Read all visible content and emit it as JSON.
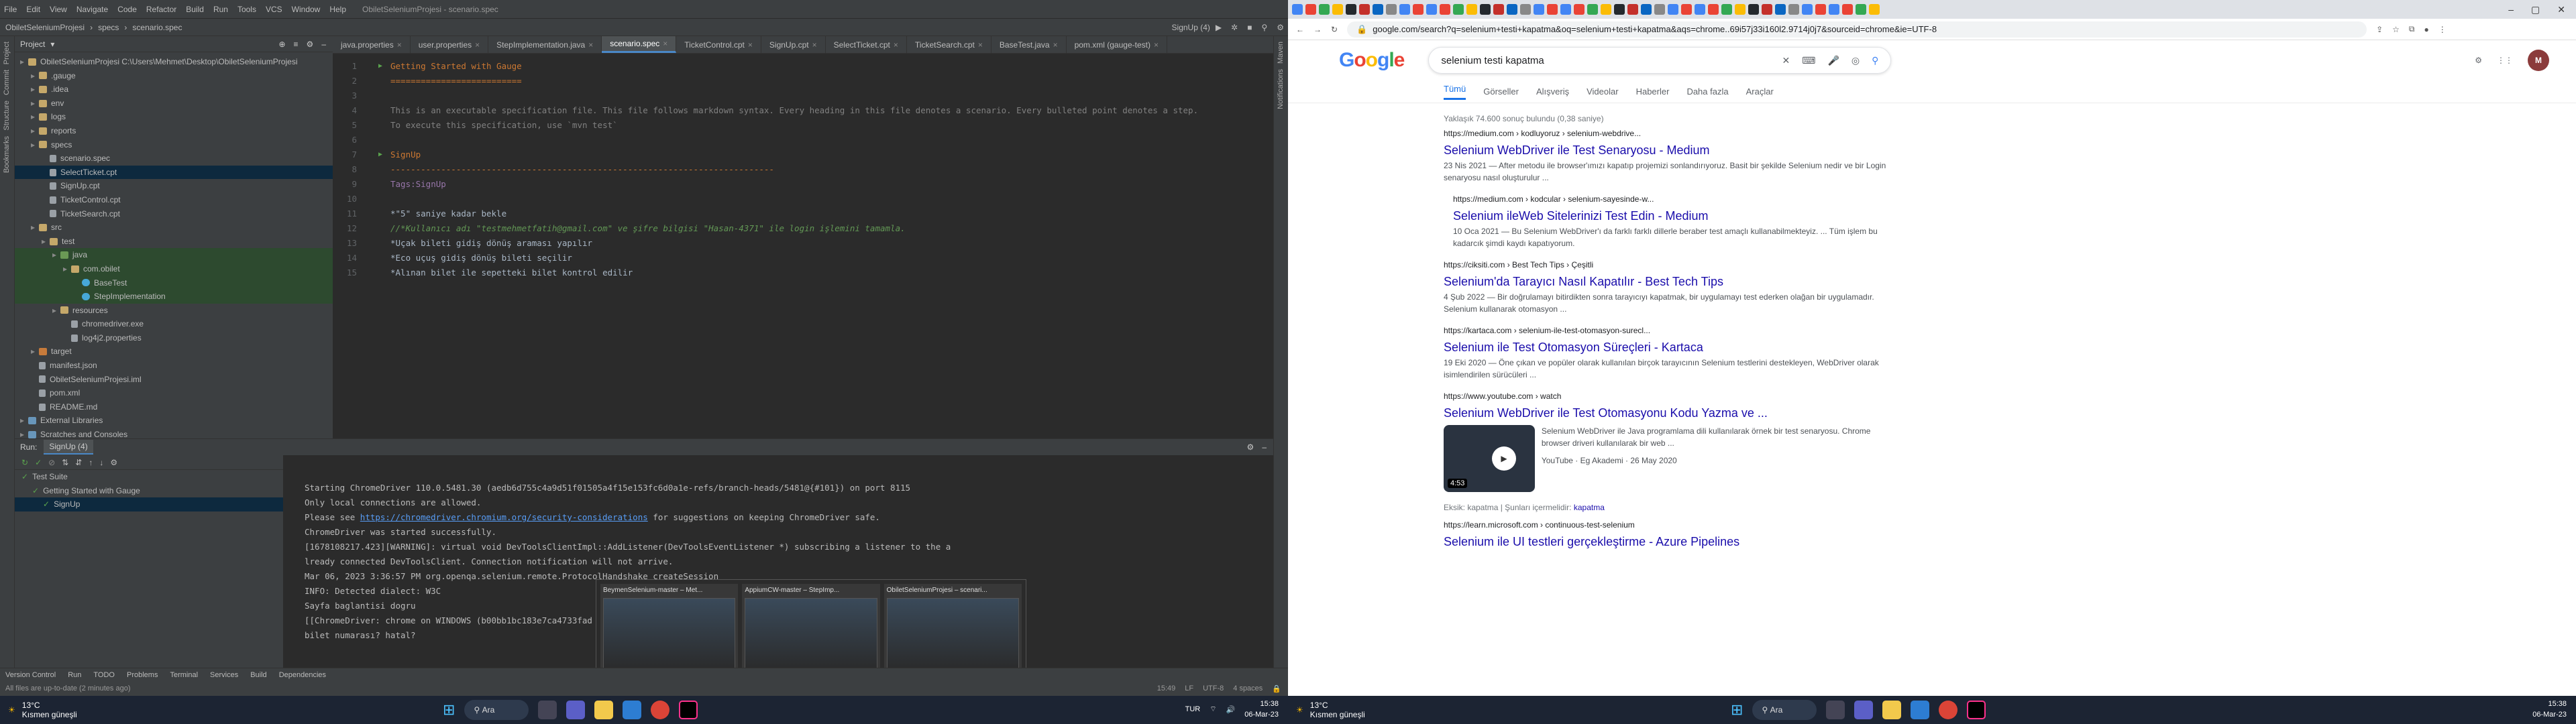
{
  "ide": {
    "menu": [
      "File",
      "Edit",
      "View",
      "Navigate",
      "Code",
      "Refactor",
      "Build",
      "Run",
      "Tools",
      "VCS",
      "Window",
      "Help"
    ],
    "window_title": "ObiletSeleniumProjesi - scenario.spec",
    "breadcrumb": [
      "ObiletSeleniumProjesi",
      "specs",
      "scenario.spec"
    ],
    "run_config": "SignUp (4)",
    "project_pane": {
      "title": "Project",
      "tree": [
        {
          "label": "ObiletSeleniumProjesi  C:\\Users\\Mehmet\\Desktop\\ObiletSeleniumProjesi",
          "icon": "fold",
          "indent": 0
        },
        {
          "label": ".gauge",
          "icon": "fold",
          "indent": 1
        },
        {
          "label": ".idea",
          "icon": "fold",
          "indent": 1
        },
        {
          "label": "env",
          "icon": "fold",
          "indent": 1
        },
        {
          "label": "logs",
          "icon": "fold",
          "indent": 1
        },
        {
          "label": "reports",
          "icon": "fold",
          "indent": 1
        },
        {
          "label": "specs",
          "icon": "fold",
          "indent": 1
        },
        {
          "label": "scenario.spec",
          "icon": "file",
          "indent": 2
        },
        {
          "label": "SelectTicket.cpt",
          "icon": "file",
          "indent": 2,
          "selected": true
        },
        {
          "label": "SignUp.cpt",
          "icon": "file",
          "indent": 2
        },
        {
          "label": "TicketControl.cpt",
          "icon": "file",
          "indent": 2
        },
        {
          "label": "TicketSearch.cpt",
          "icon": "file",
          "indent": 2
        },
        {
          "label": "src",
          "icon": "fold",
          "indent": 1
        },
        {
          "label": "test",
          "icon": "fold",
          "indent": 2
        },
        {
          "label": "java",
          "icon": "fgreen",
          "indent": 3,
          "highlight": true
        },
        {
          "label": "com.obilet",
          "icon": "fold",
          "indent": 4,
          "highlight": true
        },
        {
          "label": "BaseTest",
          "icon": "fjava",
          "indent": 5,
          "highlight": true
        },
        {
          "label": "StepImplementation",
          "icon": "fjava",
          "indent": 5,
          "highlight": true
        },
        {
          "label": "resources",
          "icon": "fold",
          "indent": 3
        },
        {
          "label": "chromedriver.exe",
          "icon": "file",
          "indent": 4
        },
        {
          "label": "log4j2.properties",
          "icon": "file",
          "indent": 4
        },
        {
          "label": "target",
          "icon": "ftarget",
          "indent": 1
        },
        {
          "label": "manifest.json",
          "icon": "file",
          "indent": 1
        },
        {
          "label": "ObiletSeleniumProjesi.iml",
          "icon": "file",
          "indent": 1
        },
        {
          "label": "pom.xml",
          "icon": "file",
          "indent": 1
        },
        {
          "label": "README.md",
          "icon": "file",
          "indent": 1
        },
        {
          "label": "External Libraries",
          "icon": "fblue",
          "indent": 0
        },
        {
          "label": "Scratches and Consoles",
          "icon": "fblue",
          "indent": 0
        }
      ]
    },
    "editor_tabs": [
      {
        "label": "java.properties",
        "active": false
      },
      {
        "label": "user.properties",
        "active": false
      },
      {
        "label": "StepImplementation.java",
        "active": false
      },
      {
        "label": "scenario.spec",
        "active": true
      },
      {
        "label": "TicketControl.cpt",
        "active": false
      },
      {
        "label": "SignUp.cpt",
        "active": false
      },
      {
        "label": "SelectTicket.cpt",
        "active": false
      },
      {
        "label": "TicketSearch.cpt",
        "active": false
      },
      {
        "label": "BaseTest.java",
        "active": false
      },
      {
        "label": "pom.xml (gauge-test)",
        "active": false
      }
    ],
    "code_lines": [
      {
        "n": "1",
        "text": "Getting Started with Gauge",
        "cls": "c-hd",
        "gutter": "▶"
      },
      {
        "n": "2",
        "text": "==========================",
        "cls": "c-sep",
        "gutter": ""
      },
      {
        "n": "3",
        "text": "",
        "cls": "txt",
        "gutter": ""
      },
      {
        "n": "4",
        "text": "This is an executable specification file. This file follows markdown syntax. Every heading in this file denotes a scenario. Every bulleted point denotes a step.",
        "cls": "c-cm",
        "gutter": ""
      },
      {
        "n": "5",
        "text": "To execute this specification, use `mvn test`",
        "cls": "c-cm",
        "gutter": ""
      },
      {
        "n": "6",
        "text": "",
        "cls": "txt",
        "gutter": ""
      },
      {
        "n": "7",
        "text": "SignUp",
        "cls": "c-hd",
        "gutter": "▶"
      },
      {
        "n": "8",
        "text": "----------------------------------------------------------------------------",
        "cls": "c-sep",
        "gutter": ""
      },
      {
        "n": "9",
        "text": "Tags:SignUp",
        "cls": "c-tag",
        "gutter": ""
      },
      {
        "n": "10",
        "text": "",
        "cls": "txt",
        "gutter": ""
      },
      {
        "n": "11",
        "text": "*\"5\" saniye kadar bekle",
        "cls": "c-step",
        "gutter": ""
      },
      {
        "n": "12",
        "text": "//*Kullanıcı adı \"testmehmetfatih@gmail.com\" ve şifre bilgisi \"Hasan-4371\" ile login işlemini tamamla.",
        "cls": "c-comment",
        "gutter": ""
      },
      {
        "n": "13",
        "text": "*Uçak bileti gidiş dönüş araması yapılır",
        "cls": "c-step",
        "gutter": ""
      },
      {
        "n": "14",
        "text": "*Eco uçuş gidiş dönüş bileti seçilir",
        "cls": "c-step",
        "gutter": ""
      },
      {
        "n": "15",
        "text": "*Alınan bilet ile sepetteki bilet kontrol edilir",
        "cls": "c-step",
        "gutter": ""
      }
    ],
    "run": {
      "label": "Run:",
      "tab": "SignUp (4)",
      "tree": [
        "Test Suite",
        "Getting Started with Gauge",
        "SignUp"
      ],
      "console": [
        "Starting ChromeDriver 110.0.5481.30 (aedb6d755c4a9d51f01505a4f15e153fc6d0a1e-refs/branch-heads/5481@{#101}) on port 8115",
        "Only local connections are allowed.",
        "Please see https://chromedriver.chromium.org/security-considerations for suggestions on keeping ChromeDriver safe.",
        "ChromeDriver was started successfully.",
        "[1678108217.423][WARNING]: virtual void DevToolsClientImpl::AddListener(DevToolsEventListener *) subscribing a listener to the a",
        "lready connected DevToolsClient. Connection notification will not arrive.",
        "Mar 06, 2023 3:36:57 PM org.openqa.selenium.remote.ProtocolHandshake createSession",
        "INFO: Detected dialect: W3C",
        "Sayfa baglantisi dogru",
        "[[ChromeDriver: chrome on WINDOWS (b00bb1bc183e7ca4733fad",
        "bilet numarası? hatal?"
      ],
      "link_text": "https://chromedriver.chromium.org/security-considerations"
    },
    "thumbnails": [
      "BeymenSelenium-master – Met...",
      "AppiumCW-master – StepImp...",
      "ObiletSeleniumProjesi – scenari..."
    ],
    "bottom_tabs": [
      "Version Control",
      "Run",
      "TODO",
      "Problems",
      "Terminal",
      "Services",
      "Build",
      "Dependencies"
    ],
    "status": {
      "msg": "All files are up-to-date (2 minutes ago)",
      "pos": "15:49",
      "sep": "LF",
      "enc": "UTF-8",
      "indent": "4 spaces"
    }
  },
  "browser": {
    "url": "google.com/search?q=selenium+testi+kapatma&oq=selenium+testi+kapatma&aqs=chrome..69i57j33i160l2.9714j0j7&sourceid=chrome&ie=UTF-8",
    "query": "selenium testi kapatma",
    "logo": "Google",
    "avatar": "M",
    "tabs": [
      "Tümü",
      "Görseller",
      "Alışveriş",
      "Videolar",
      "Haberler",
      "Daha fazla",
      "Araçlar"
    ],
    "stats": "Yaklaşık 74.600 sonuç bulundu (0,38 saniye)",
    "results": [
      {
        "cite": "https://medium.com › kodluyoruz › selenium-webdrive...",
        "title": "Selenium WebDriver ile Test Senaryosu - Medium",
        "snippet": "23 Nis 2021 — After metodu ile browser'ımızı kapatıp projemizi sonlandırıyoruz. Basit bir şekilde Selenium nedir ve bir Login senaryosu nasıl oluşturulur ...",
        "indent": false
      },
      {
        "cite": "https://medium.com › kodcular › selenium-sayesinde-w...",
        "title": "Selenium ileWeb Sitelerinizi Test Edin - Medium",
        "snippet": "10 Oca 2021 — Bu Selenium WebDriver'ı da farklı farklı dillerle beraber test amaçlı kullanabilmekteyiz. ... Tüm işlem bu kadarcık şimdi kaydı kapatıyorum.",
        "indent": true
      },
      {
        "cite": "https://ciksiti.com › Best Tech Tips › Çeşitli",
        "title": "Selenium'da Tarayıcı Nasıl Kapatılır - Best Tech Tips",
        "snippet": "4 Şub 2022 — Bir doğrulamayı bitirdikten sonra tarayıcıyı kapatmak, bir uygulamayı test ederken olağan bir uygulamadır. Selenium kullanarak otomasyon ...",
        "indent": false
      },
      {
        "cite": "https://kartaca.com › selenium-ile-test-otomasyon-surecl...",
        "title": "Selenium ile Test Otomasyon Süreçleri - Kartaca",
        "snippet": "19 Eki 2020 — Öne çıkan ve popüler olarak kullanılan birçok tarayıcının Selenium testlerini destekleyen, WebDriver olarak isimlendirilen sürücüleri ...",
        "indent": false
      },
      {
        "cite": "https://www.youtube.com › watch",
        "title": "Selenium WebDriver ile Test Otomasyonu Kodu Yazma ve ...",
        "snippet": "Selenium WebDriver ile Java programlama dili kullanılarak örnek bir test senaryosu. Chrome browser driveri kullanılarak bir web ...",
        "indent": false,
        "video": {
          "duration": "4:53",
          "channel": "YouTube · Eg Akademi · 26 May 2020"
        }
      },
      {
        "cite": "https://learn.microsoft.com › continuous-test-selenium",
        "title": "Selenium ile UI testleri gerçekleştirme - Azure Pipelines",
        "snippet": "",
        "indent": false
      }
    ],
    "related_prefix": "Eksik: kapatma | Şunları içermelidir: ",
    "related_link": "kapatma"
  },
  "taskbar": {
    "temp": "13°C",
    "weather": "Kısmen güneşli",
    "search": "Ara",
    "lang": "TUR",
    "time": "15:38",
    "date": "06-Mar-23"
  }
}
